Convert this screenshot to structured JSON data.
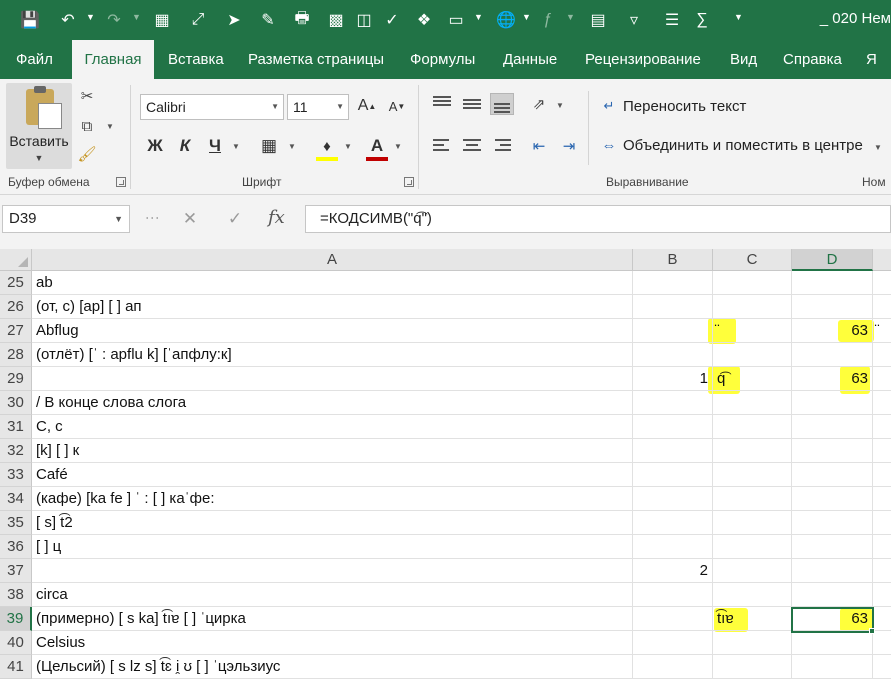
{
  "window": {
    "title": "_ 020 Нем"
  },
  "ribbon_tabs": [
    {
      "label": "Файл"
    },
    {
      "label": "Главная"
    },
    {
      "label": "Вставка"
    },
    {
      "label": "Разметка страницы"
    },
    {
      "label": "Формулы"
    },
    {
      "label": "Данные"
    },
    {
      "label": "Рецензирование"
    },
    {
      "label": "Вид"
    },
    {
      "label": "Справка"
    },
    {
      "label": "Я"
    }
  ],
  "active_tab": "Главная",
  "clipboard": {
    "paste_label": "Вставить",
    "group_label": "Буфер обмена"
  },
  "font": {
    "name": "Calibri",
    "size": "11",
    "bold_label": "Ж",
    "italic_label": "К",
    "underline_label": "Ч",
    "grow_label": "A",
    "shrink_label": "A",
    "color_label": "A",
    "group_label": "Шрифт",
    "highlight_color": "#FFFF00",
    "text_color": "#C00000"
  },
  "alignment": {
    "wrap_text_label": "Переносить текст",
    "merge_center_label": "Объединить и поместить в центре",
    "group_label": "Выравнивание",
    "next_group_label": "Ном"
  },
  "formula_bar": {
    "name_box": "D39",
    "formula": "=КОДСИМВ(\"q͡\")"
  },
  "columns": [
    {
      "label": "A"
    },
    {
      "label": "B"
    },
    {
      "label": "C"
    },
    {
      "label": "D"
    }
  ],
  "selected_cell": "D39",
  "rows": [
    {
      "num": "25",
      "a": "ab",
      "b": "",
      "c": "",
      "d": "",
      "e": ""
    },
    {
      "num": "26",
      "a": "(от, с) [ap] [ ] ап",
      "b": "",
      "c": "",
      "d": "",
      "e": ""
    },
    {
      "num": "27",
      "a": "Abflug",
      "b": "",
      "c": "̈",
      "d": "63",
      "e": "̈"
    },
    {
      "num": "28",
      "a": "(отлёт) [ˈ : apflu k] [ˈапфлу:к]",
      "b": "",
      "c": "",
      "d": "",
      "e": ""
    },
    {
      "num": "29",
      "a": "",
      "b": "1",
      "c": "q͡",
      "d": "63",
      "e": ""
    },
    {
      "num": "30",
      "a": " / В конце слова слога",
      "b": "",
      "c": "",
      "d": "",
      "e": ""
    },
    {
      "num": "31",
      "a": "C, c",
      "b": "",
      "c": "",
      "d": "",
      "e": ""
    },
    {
      "num": "32",
      "a": "[k] [ ] к",
      "b": "",
      "c": "",
      "d": "",
      "e": ""
    },
    {
      "num": "33",
      "a": "Café",
      "b": "",
      "c": "",
      "d": "",
      "e": ""
    },
    {
      "num": "34",
      "a": "(кафе) [ka fe ] ˈ : [ ] каˈфе:",
      "b": "",
      "c": "",
      "d": "",
      "e": ""
    },
    {
      "num": "35",
      "a": "[ s] t͡2",
      "b": "",
      "c": "",
      "d": "",
      "e": ""
    },
    {
      "num": "36",
      "a": "[ ] ц",
      "b": "",
      "c": "",
      "d": "",
      "e": ""
    },
    {
      "num": "37",
      "a": "",
      "b": "2",
      "c": "",
      "d": "",
      "e": ""
    },
    {
      "num": "38",
      "a": "circa",
      "b": "",
      "c": "",
      "d": "",
      "e": ""
    },
    {
      "num": "39",
      "a": "(примерно) [ s ka]  t͡ıɐ [ ] ˈцирка",
      "b": "",
      "c": "t͡ıɐ",
      "d": "63",
      "e": ""
    },
    {
      "num": "40",
      "a": "Celsius",
      "b": "",
      "c": "",
      "d": "",
      "e": ""
    },
    {
      "num": "41",
      "a": "(Цельсий) [ s lz s]  t͡ɛ i̯ ʊ [ ] ˈцэльзиус",
      "b": "",
      "c": "",
      "d": "",
      "e": ""
    }
  ],
  "colors": {
    "excel_green": "#217346",
    "highlight_yellow": "#FFFF3B"
  }
}
